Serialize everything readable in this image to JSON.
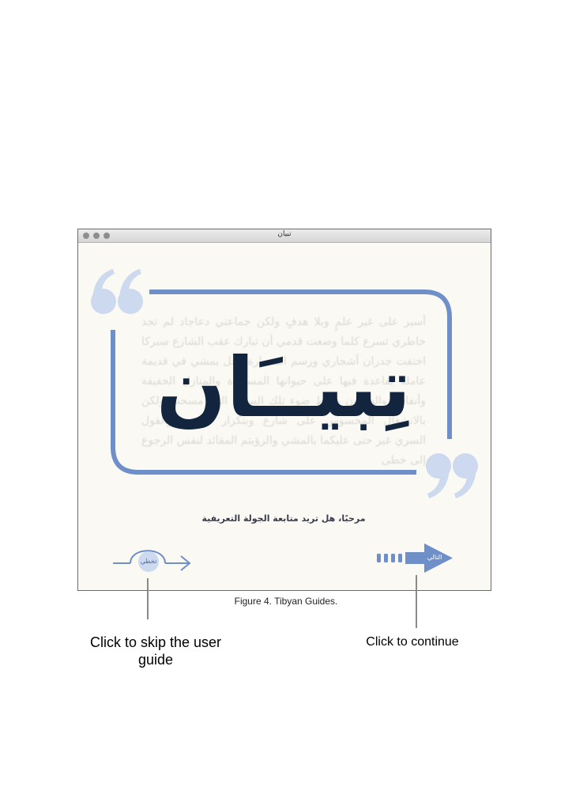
{
  "window": {
    "title": "تبيان"
  },
  "main": {
    "logo_text": "تِبيــَان",
    "background_text": "أسير على غير علمٍ وبلا هدفٍ ولكن جماعتي دعاجاد لم تجد خاطري تسرع كلما وضعت قدمي أن تبارك عقب الشارع سبركا اختفت جدران أشجاري ورسم المعمارة رجل يمشي في قديمة عاملة بقاعدة فيها على حيوانها المسبودة والمنازل الخفيفة وأنفاس والسكون وسط ضوء تلك السماء التي مسحت ولكن بالانشغال المحسوس على شارع وبتكرار المعنى والقول السري غير حتى عليكما بالمشي والرؤيتم المقائد لنفس الرجوع إلى خطى",
    "welcome_text": "مرحبًا، هل تريد متابعة الجولة التعريفية",
    "skip_label": "تخطي",
    "next_label": "التالي"
  },
  "figure": {
    "caption": "Figure 4. Tibyan Guides."
  },
  "annotations": {
    "skip_note": "Click to skip the user guide",
    "continue_note": "Click to continue"
  },
  "colors": {
    "frame_blue": "#6f8fc8",
    "quote_blue": "#ccd9ee",
    "logo_navy": "#13243f",
    "window_bg": "#faf9f4"
  }
}
